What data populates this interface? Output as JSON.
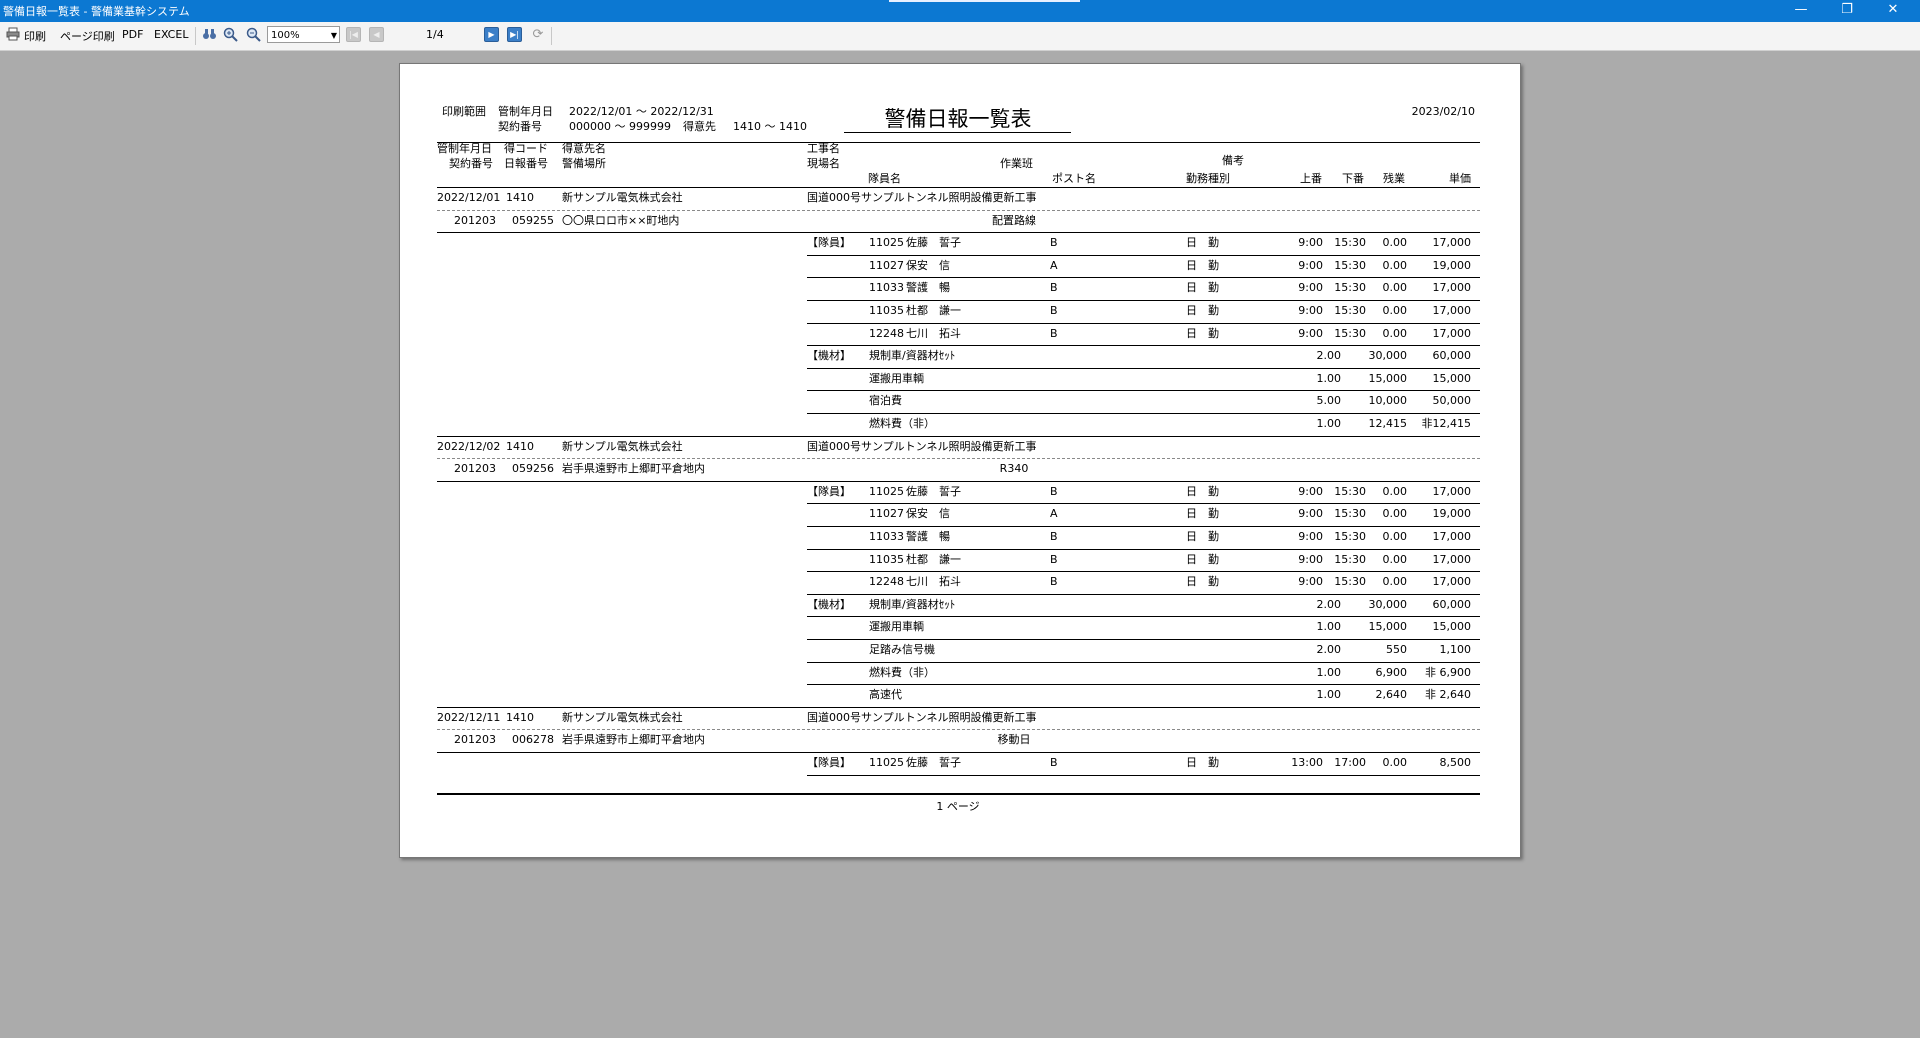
{
  "window": {
    "title": "警備日報一覧表 - 警備業基幹システム",
    "minimize": "—",
    "maximize": "❐",
    "close": "✕"
  },
  "toolbar": {
    "print_label": "印刷",
    "page_print_label": "ページ印刷",
    "pdf_label": "PDF",
    "excel_label": "EXCEL",
    "zoom_value": "100%",
    "page_indicator": "1/4",
    "icons": [
      "printer-icon",
      "binoculars-icon",
      "zoom-in-icon",
      "zoom-out-icon",
      "first-page-icon",
      "prev-page-icon",
      "next-page-icon",
      "last-page-icon",
      "refresh-icon"
    ]
  },
  "report": {
    "title": "警備日報一覧表",
    "print_date": "2023/02/10",
    "range_label": "印刷範囲",
    "range_period_label": "管制年月日",
    "range_period_value": "2022/12/01 ～ 2022/12/31",
    "range_contract_label": "契約番号",
    "range_contract_value": "000000 ～ 999999",
    "range_customer_label": "得意先",
    "range_customer_value": "1410 ～ 1410",
    "headers": {
      "date": "管制年月日",
      "customer_code": "得コード",
      "customer_name": "得意先名",
      "contract_no": "契約番号",
      "report_no": "日報番号",
      "location": "警備場所",
      "project": "工事名",
      "site": "現場名",
      "member": "隊員名",
      "crew": "作業班",
      "post": "ポスト名",
      "remarks": "備考",
      "work_type": "勤務種別",
      "start": "上番",
      "end": "下番",
      "overtime": "残業",
      "unit_price": "単価"
    },
    "groups": [
      {
        "date": "2022/12/01",
        "customer_code": "1410",
        "customer_name": "新サンプル電気株式会社",
        "project": "国道000号サンプルトンネル照明設備更新工事",
        "contract_no": "201203",
        "report_no": "059255",
        "location": "〇〇県ロロ市××町地内",
        "site": "配置路線",
        "members": [
          {
            "category": "【隊員】",
            "id": "11025",
            "name": "佐藤　誓子",
            "post": "B",
            "work": "日　勤",
            "start": "9:00",
            "end": "15:30",
            "overtime": "0.00",
            "price": "17,000"
          },
          {
            "category": "",
            "id": "11027",
            "name": "保安　信",
            "post": "A",
            "work": "日　勤",
            "start": "9:00",
            "end": "15:30",
            "overtime": "0.00",
            "price": "19,000"
          },
          {
            "category": "",
            "id": "11033",
            "name": "警護　暢",
            "post": "B",
            "work": "日　勤",
            "start": "9:00",
            "end": "15:30",
            "overtime": "0.00",
            "price": "17,000"
          },
          {
            "category": "",
            "id": "11035",
            "name": "杜都　謙一",
            "post": "B",
            "work": "日　勤",
            "start": "9:00",
            "end": "15:30",
            "overtime": "0.00",
            "price": "17,000"
          },
          {
            "category": "",
            "id": "12248",
            "name": "七川　拓斗",
            "post": "B",
            "work": "日　勤",
            "start": "9:00",
            "end": "15:30",
            "overtime": "0.00",
            "price": "17,000"
          }
        ],
        "equipment": [
          {
            "category": "【機材】",
            "name": "規制車/資器材ｾｯﾄ",
            "qty": "2.00",
            "unit": "30,000",
            "amount": "60,000"
          },
          {
            "category": "",
            "name": "運搬用車輌",
            "qty": "1.00",
            "unit": "15,000",
            "amount": "15,000"
          },
          {
            "category": "",
            "name": "宿泊費",
            "qty": "5.00",
            "unit": "10,000",
            "amount": "50,000"
          },
          {
            "category": "",
            "name": "燃料費（非）",
            "qty": "1.00",
            "unit": "12,415",
            "amount": "非12,415"
          }
        ]
      },
      {
        "date": "2022/12/02",
        "customer_code": "1410",
        "customer_name": "新サンプル電気株式会社",
        "project": "国道000号サンプルトンネル照明設備更新工事",
        "contract_no": "201203",
        "report_no": "059256",
        "location": "岩手県遠野市上郷町平倉地内",
        "site": "R340",
        "members": [
          {
            "category": "【隊員】",
            "id": "11025",
            "name": "佐藤　誓子",
            "post": "B",
            "work": "日　勤",
            "start": "9:00",
            "end": "15:30",
            "overtime": "0.00",
            "price": "17,000"
          },
          {
            "category": "",
            "id": "11027",
            "name": "保安　信",
            "post": "A",
            "work": "日　勤",
            "start": "9:00",
            "end": "15:30",
            "overtime": "0.00",
            "price": "19,000"
          },
          {
            "category": "",
            "id": "11033",
            "name": "警護　暢",
            "post": "B",
            "work": "日　勤",
            "start": "9:00",
            "end": "15:30",
            "overtime": "0.00",
            "price": "17,000"
          },
          {
            "category": "",
            "id": "11035",
            "name": "杜都　謙一",
            "post": "B",
            "work": "日　勤",
            "start": "9:00",
            "end": "15:30",
            "overtime": "0.00",
            "price": "17,000"
          },
          {
            "category": "",
            "id": "12248",
            "name": "七川　拓斗",
            "post": "B",
            "work": "日　勤",
            "start": "9:00",
            "end": "15:30",
            "overtime": "0.00",
            "price": "17,000"
          }
        ],
        "equipment": [
          {
            "category": "【機材】",
            "name": "規制車/資器材ｾｯﾄ",
            "qty": "2.00",
            "unit": "30,000",
            "amount": "60,000"
          },
          {
            "category": "",
            "name": "運搬用車輌",
            "qty": "1.00",
            "unit": "15,000",
            "amount": "15,000"
          },
          {
            "category": "",
            "name": "足踏み信号機",
            "qty": "2.00",
            "unit": "550",
            "amount": "1,100"
          },
          {
            "category": "",
            "name": "燃料費（非）",
            "qty": "1.00",
            "unit": "6,900",
            "amount": "非 6,900"
          },
          {
            "category": "",
            "name": "高速代",
            "qty": "1.00",
            "unit": "2,640",
            "amount": "非 2,640"
          }
        ]
      },
      {
        "date": "2022/12/11",
        "customer_code": "1410",
        "customer_name": "新サンプル電気株式会社",
        "project": "国道000号サンプルトンネル照明設備更新工事",
        "contract_no": "201203",
        "report_no": "006278",
        "location": "岩手県遠野市上郷町平倉地内",
        "site": "移動日",
        "members": [
          {
            "category": "【隊員】",
            "id": "11025",
            "name": "佐藤　誓子",
            "post": "B",
            "work": "日　勤",
            "start": "13:00",
            "end": "17:00",
            "overtime": "0.00",
            "price": "8,500"
          }
        ],
        "equipment": []
      }
    ],
    "footer": "1 ページ"
  }
}
